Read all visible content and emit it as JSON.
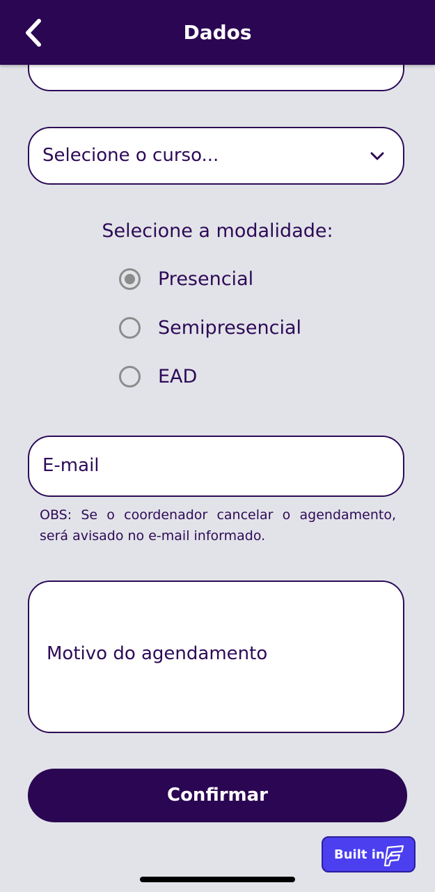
{
  "header": {
    "title": "Dados"
  },
  "course_select": {
    "placeholder": "Selecione o curso..."
  },
  "modalidade": {
    "title": "Selecione a modalidade:",
    "options": [
      {
        "label": "Presencial",
        "selected": true
      },
      {
        "label": "Semipresencial",
        "selected": false
      },
      {
        "label": "EAD",
        "selected": false
      }
    ]
  },
  "email": {
    "placeholder": "E-mail",
    "note": "OBS: Se o coordenador cancelar o agendamento, será avisado no e-mail informado."
  },
  "motivo": {
    "placeholder": "Motivo do agendamento"
  },
  "confirm": {
    "label": "Confirmar"
  },
  "badge": {
    "label": "Built in"
  },
  "colors": {
    "primary": "#2b0653",
    "background": "#e2e3e8",
    "badge": "#4b3ff0"
  }
}
